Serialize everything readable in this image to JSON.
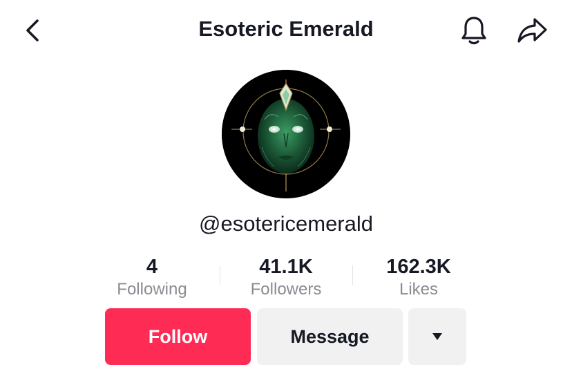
{
  "header": {
    "title": "Esoteric Emerald",
    "back_icon": "chevron-left-icon",
    "bell_icon": "bell-icon",
    "share_icon": "share-arrow-icon"
  },
  "profile": {
    "username": "@esotericemerald",
    "avatar_icon": "emerald-face-avatar"
  },
  "stats": [
    {
      "value": "4",
      "label": "Following"
    },
    {
      "value": "41.1K",
      "label": "Followers"
    },
    {
      "value": "162.3K",
      "label": "Likes"
    }
  ],
  "actions": {
    "follow_label": "Follow",
    "message_label": "Message",
    "more_icon": "caret-down-icon"
  },
  "colors": {
    "accent": "#fe2c55",
    "secondary_button": "#f1f1f2",
    "muted_text": "#8a8b91",
    "primary_text": "#161823"
  }
}
